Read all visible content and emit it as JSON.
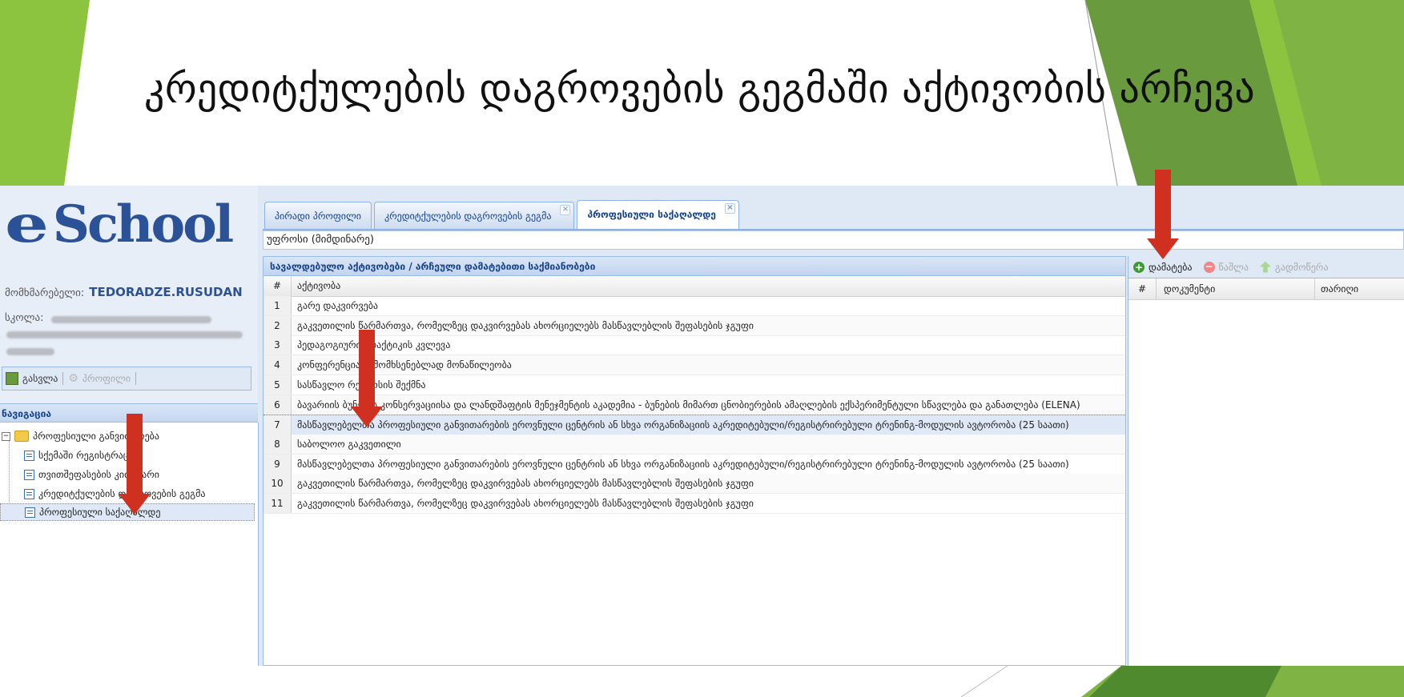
{
  "slide": {
    "title": "კრედიტქულების დაგროვების გეგმაში აქტივობის არჩევა"
  },
  "colors": {
    "green_light": "#8cc43f",
    "green_dark": "#5e8f36",
    "arrow_red": "#d03020",
    "brand_blue": "#2b5197"
  },
  "app": {
    "logo": {
      "e": "e",
      "text": "School"
    },
    "user": {
      "label": "მომხმარებელი:",
      "name": "TEDORADZE.RUSUDAN"
    },
    "school": {
      "label": "სკოლა:"
    },
    "toolbar": {
      "exit_label": "გასვლა",
      "profile_label": "პროფილი"
    },
    "nav": {
      "header": "ნავიგაცია",
      "root": "პროფესიული განვითარება",
      "items": [
        "სქემაში რეგისტრაცია",
        "თვითშეფასების კითხვარი",
        "კრედიტქულების დაგროვების გეგმა",
        "პროფესიული საქაღალდე"
      ]
    },
    "tabs": [
      {
        "label": "პირადი პროფილი"
      },
      {
        "label": "კრედიტქულების დაგროვების გეგმა",
        "close": "×"
      },
      {
        "label": "პროფესიული საქაღალდე",
        "close": "×"
      }
    ],
    "select": {
      "value": "უფროსი (მიმდინარე)"
    },
    "grid": {
      "title": "სავალდებულო აქტივობები / არჩეული დამატებითი საქმიანობები",
      "col_num": "#",
      "col_activity": "აქტივობა",
      "rows": [
        {
          "n": "1",
          "text": "გარე დაკვირვება"
        },
        {
          "n": "2",
          "text": "გაკვეთილის წარმართვა, რომელზეც დაკვირვებას ახორციელებს მასწავლებლის შეფასების ჯგუფი"
        },
        {
          "n": "3",
          "text": "პედაგოგიური პრაქტიკის კვლევა"
        },
        {
          "n": "4",
          "text": "კონფერენციაში მომხსენებლად მონაწილეობა"
        },
        {
          "n": "5",
          "text": "სასწავლო რესურსის შექმნა"
        },
        {
          "n": "6",
          "text": "ბავარიის ბუნების კონსერვაციისა და ლანდშაფტის მენეჯმენტის აკადემია - ბუნების მიმართ ცნობიერების ამაღლების ექსპერიმენტული სწავლება და განათლება (ELENA)"
        },
        {
          "n": "7",
          "text": "მასწავლებელთა პროფესიული განვითარების ეროვნული ცენტრის ან სხვა ორგანიზაციის აკრედიტებული/რეგისტრირებული ტრენინგ-მოდულის ავტორობა (25 საათი)"
        },
        {
          "n": "8",
          "text": "საბოლოო გაკვეთილი"
        },
        {
          "n": "9",
          "text": "მასწავლებელთა პროფესიული განვითარების ეროვნული ცენტრის ან სხვა ორგანიზაციის აკრედიტებული/რეგისტრირებული ტრენინგ-მოდულის ავტორობა (25 საათი)"
        },
        {
          "n": "10",
          "text": "გაკვეთილის წარმართვა, რომელზეც დაკვირვებას ახორციელებს მასწავლებლის შეფასების ჯგუფი"
        },
        {
          "n": "11",
          "text": "გაკვეთილის წარმართვა, რომელზეც დაკვირვებას ახორციელებს მასწავლებლის შეფასების ჯგუფი"
        }
      ]
    },
    "docs": {
      "add_label": "დამატება",
      "delete_label": "წაშლა",
      "upload_label": "გადმოწერა",
      "col_num": "#",
      "col_doc": "დოკუმენტი",
      "col_date": "თარიღი"
    }
  }
}
